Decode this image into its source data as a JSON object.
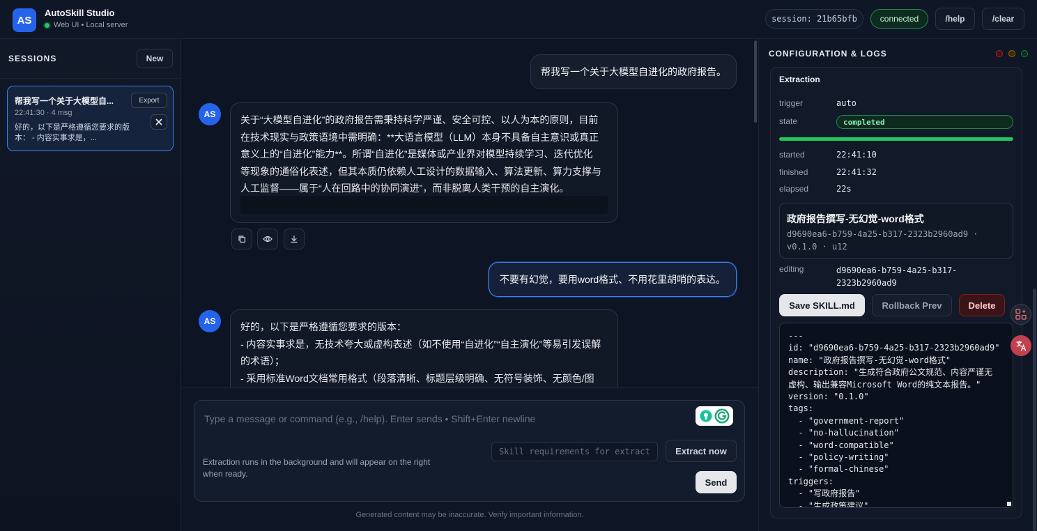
{
  "header": {
    "logo_text": "AS",
    "title": "AutoSkill Studio",
    "subtitle": "Web UI • Local server",
    "session_label": "session: 21b65bfb",
    "status": "connected",
    "help_label": "/help",
    "clear_label": "/clear",
    "colors": {
      "accent": "#2563eb",
      "connected": "#22c55e"
    }
  },
  "sidebar": {
    "title": "SESSIONS",
    "new_label": "New",
    "sessions": [
      {
        "title": "帮我写一个关于大模型自...",
        "meta": "22:41:30 · 4 msg",
        "preview": "好的，以下是严格遵循您要求的版本： - 内容实事求是，...",
        "export_label": "Export"
      }
    ]
  },
  "chat": {
    "messages": [
      {
        "role": "user",
        "text": "帮我写一个关于大模型自进化的政府报告。"
      },
      {
        "role": "assistant",
        "avatar": "AS",
        "lines": [
          "关于“大模型自进化”的政府报告需秉持科学严谨、安全可控、以人为本的原则，目前",
          "在技术现实与政策语境中需明确：**大语言模型（LLM）本身不具备自主意识或真正",
          "意义上的“自进化”能力**。所谓“自进化”是媒体或产业界对模型持续学习、迭代优化",
          "等现象的通俗化表述，但其本质仍依赖人工设计的数据输入、算法更新、算力支撑与",
          "人工监督——属于“人在回路中的协同演进”，而非脱离人类干预的自主演化。"
        ]
      },
      {
        "role": "user",
        "text": "不要有幻觉，要用word格式、不用花里胡哨的表达。"
      },
      {
        "role": "assistant",
        "avatar": "AS",
        "lines": [
          "好的，以下是严格遵循您要求的版本：",
          "- 内容实事求是，无技术夸大或虚构表述（如不使用“自进化”“自主演化”等易引发误解",
          "的术语）；",
          "- 采用标准Word文档常用格式（段落清晰、标题层级明确、无符号装饰、无颜色/图"
        ]
      }
    ],
    "message_actions": [
      "copy-icon",
      "eye-icon",
      "download-icon"
    ]
  },
  "composer": {
    "placeholder": "Type a message or command (e.g., /help). Enter sends • Shift+Enter newline",
    "skill_placeholder": "Skill requirements for extract",
    "extract_label": "Extract now",
    "send_label": "Send",
    "note": "Extraction runs in the background and will appear on the right when ready.",
    "disclaimer": "Generated content may be inaccurate. Verify important information."
  },
  "panel": {
    "title": "CONFIGURATION & LOGS",
    "extraction": {
      "title": "Extraction",
      "trigger_label": "trigger",
      "trigger": "auto",
      "state_label": "state",
      "state": "completed",
      "progress": 1.0,
      "started_label": "started",
      "started": "22:41:10",
      "finished_label": "finished",
      "finished": "22:41:32",
      "elapsed_label": "elapsed",
      "elapsed": "22s"
    },
    "skill": {
      "name": "政府报告撰写-无幻觉-word格式",
      "id_line1": "d9690ea6-b759-4a25-b317-2323b2960ad9 ·",
      "id_line2": "v0.1.0 · u12",
      "editing_label": "editing",
      "editing_line1": "d9690ea6-b759-4a25-b317-",
      "editing_line2": "2323b2960ad9"
    },
    "buttons": {
      "save": "Save SKILL.md",
      "rollback": "Rollback Prev",
      "delete": "Delete"
    },
    "editor_lines": [
      "---",
      "id: \"d9690ea6-b759-4a25-b317-2323b2960ad9\"",
      "name: \"政府报告撰写-无幻觉-word格式\"",
      "description: \"生成符合政府公文规范、内容严谨无",
      "虚构、输出兼容Microsoft Word的纯文本报告。\"",
      "version: \"0.1.0\"",
      "tags:",
      "  - \"government-report\"",
      "  - \"no-hallucination\"",
      "  - \"word-compatible\"",
      "  - \"policy-writing\"",
      "  - \"formal-chinese\"",
      "triggers:",
      "  - \"写政府报告\"",
      "  - \"生成政策建议\""
    ]
  }
}
